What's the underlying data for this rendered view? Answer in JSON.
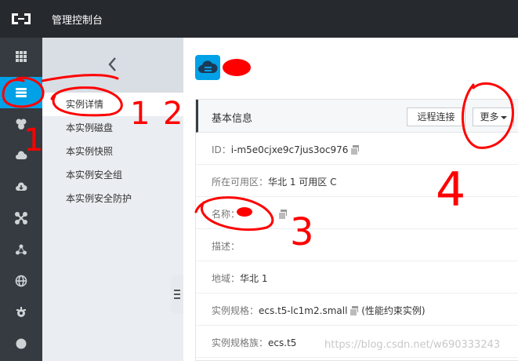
{
  "app": {
    "title": "管理控制台"
  },
  "rail": {
    "items": [
      {
        "icon": "grid-icon",
        "active": false
      },
      {
        "icon": "server-icon",
        "active": true
      },
      {
        "icon": "database-icon",
        "active": false
      },
      {
        "icon": "cloud-icon",
        "active": false
      },
      {
        "icon": "cloud-download-icon",
        "active": false
      },
      {
        "icon": "network-icon",
        "active": false
      },
      {
        "icon": "nodes-icon",
        "active": false
      },
      {
        "icon": "globe-icon",
        "active": false
      },
      {
        "icon": "gear-icon",
        "active": false
      },
      {
        "icon": "circle-icon",
        "active": false
      }
    ]
  },
  "subnav": {
    "items": [
      {
        "label": "实例详情",
        "active": true
      },
      {
        "label": "本实例磁盘",
        "active": false
      },
      {
        "label": "本实例快照",
        "active": false
      },
      {
        "label": "本实例安全组",
        "active": false
      },
      {
        "label": "本实例安全防护",
        "active": false
      }
    ]
  },
  "panel": {
    "title": "基本信息",
    "remote_button": "远程连接",
    "more_button": "更多",
    "rows": [
      {
        "label": "ID：",
        "value": "i-m5e0cjxe9c7jus3oc976"
      },
      {
        "label": "所在可用区：",
        "value": "华北 1 可用区 C"
      },
      {
        "label": "名称：",
        "value": ""
      },
      {
        "label": "描述：",
        "value": ""
      },
      {
        "label": "地域：",
        "value": "华北 1"
      },
      {
        "label": "实例规格：",
        "value": "ecs.t5-lc1m2.small",
        "suffix": "(性能约束实例)"
      },
      {
        "label": "实例规格族：",
        "value": "ecs.t5"
      }
    ]
  },
  "annotations": [
    "1",
    "1",
    "2",
    "3",
    "4"
  ],
  "watermark": "https://blog.csdn.net/w690333243",
  "colors": {
    "accent": "#00a1e6",
    "topbar": "#262a2e",
    "rail": "#353b40",
    "ink": "#ff0000"
  }
}
